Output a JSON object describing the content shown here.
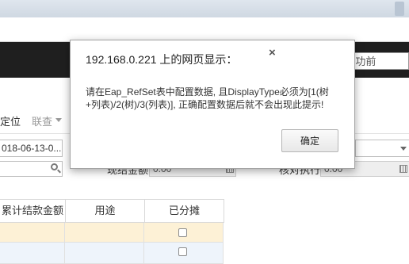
{
  "dialog": {
    "title": "192.168.0.221 上的网页显示：",
    "close": "×",
    "message": "请在Eap_RefSet表中配置数据, 且DisplayType必须为[1(树+列表)/2(树)/3(列表)], 正确配置数据后就不会出现此提示!",
    "ok_label": "确定"
  },
  "header": {
    "search_text": "索-产品功前"
  },
  "toolbar": {
    "locate_label": "定位",
    "linked_label": "联查"
  },
  "form": {
    "date_value": "018-06-13-0...",
    "search_value": "",
    "amount_label": "现结金额",
    "amount_value": "0.00",
    "balance_label": "核对执行",
    "balance_value": "0.00"
  },
  "grid": {
    "columns": [
      "累计结款金额",
      "用途",
      "已分摊"
    ]
  }
}
